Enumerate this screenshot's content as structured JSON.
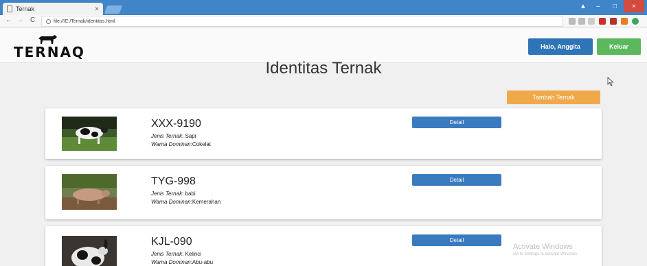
{
  "browser": {
    "tab_title": "Ternak",
    "tab_close": "×",
    "url": "file:///E:/Ternak/identitas.html",
    "controls": {
      "minimize": "–",
      "maximize": "□",
      "close": "×"
    },
    "nav": {
      "back": "←",
      "forward": "→",
      "reload": "C"
    }
  },
  "navbar": {
    "logo_text": "TERNAQ",
    "greet_button": "Halo, Anggita",
    "logout_button": "Keluar"
  },
  "main": {
    "title": "Identitas Ternak",
    "add_button": "Tambah Ternak"
  },
  "labels": {
    "type_label": "Jenis Ternak",
    "color_label": "Warna Dominan",
    "detail_button": "Detail"
  },
  "livestock": [
    {
      "id": "XXX-9190",
      "type": ": Sapi",
      "color": ":Cokelat"
    },
    {
      "id": "TYG-998",
      "type": ": babi",
      "color": ":Kemerahan"
    },
    {
      "id": "KJL-090",
      "type": ": Kelinci",
      "color": ":Abu-abu"
    }
  ],
  "watermark": {
    "title": "Activate Windows",
    "subtitle": "Go to Settings to activate Windows."
  },
  "colors": {
    "accent_blue": "#2f74b6",
    "success_green": "#5cb85c",
    "warning_orange": "#f0a94a",
    "tab_bar": "#3f85c8"
  }
}
